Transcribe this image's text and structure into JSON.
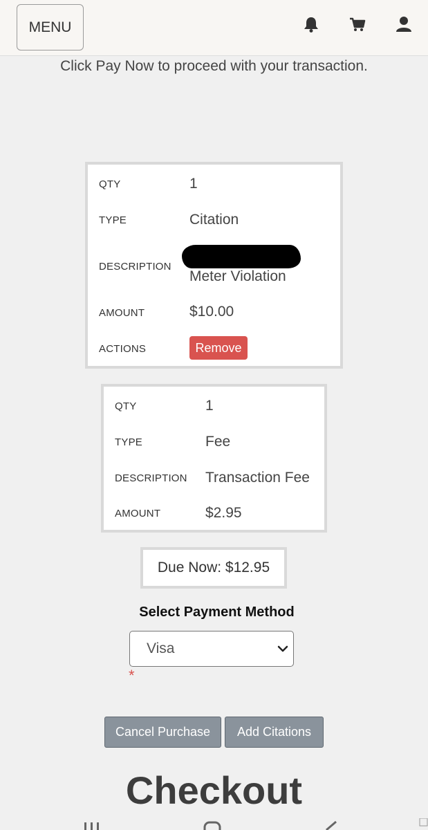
{
  "header": {
    "menu_label": "MENU",
    "icons": [
      "bell-icon",
      "cart-icon",
      "user-icon"
    ]
  },
  "intro_text": "Click Pay Now to proceed with your transaction.",
  "items": [
    {
      "qty_label": "QTY",
      "qty": "1",
      "type_label": "TYPE",
      "type": "Citation",
      "description_label": "DESCRIPTION",
      "description": "Meter Violation",
      "amount_label": "AMOUNT",
      "amount": "$10.00",
      "actions_label": "ACTIONS",
      "remove_label": "Remove"
    },
    {
      "qty_label": "QTY",
      "qty": "1",
      "type_label": "TYPE",
      "type": "Fee",
      "description_label": "DESCRIPTION",
      "description": "Transaction Fee",
      "amount_label": "AMOUNT",
      "amount": "$2.95"
    }
  ],
  "due_now": "Due Now: $12.95",
  "payment": {
    "title": "Select Payment Method",
    "selected": "Visa",
    "required_marker": "*"
  },
  "buttons": {
    "cancel": "Cancel Purchase",
    "add_citations": "Add Citations"
  },
  "checkout_heading": "Checkout",
  "colors": {
    "remove": "#d9534f",
    "gray_button": "#8a939c",
    "background": "#f0f0f0"
  }
}
